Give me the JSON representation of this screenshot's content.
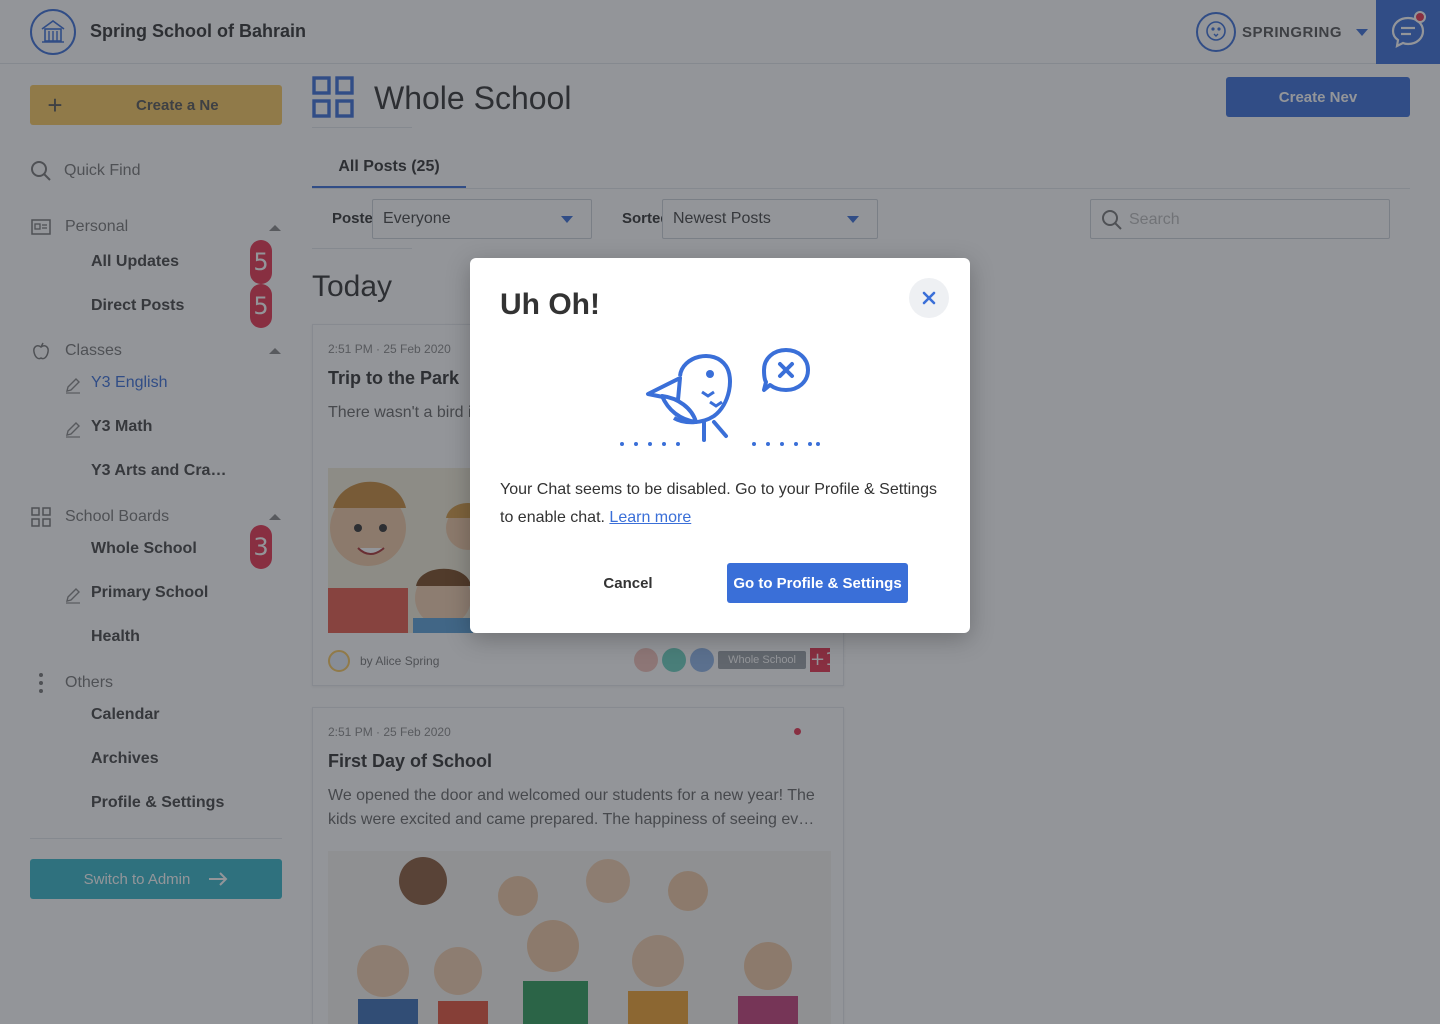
{
  "header": {
    "school_name": "Spring School of Bahrain",
    "user_name": "SPRINGRING"
  },
  "sidebar": {
    "create_label": "Create a Ne",
    "quick_find": "Quick Find",
    "sections": {
      "personal": {
        "label": "Personal",
        "items": [
          {
            "label": "All Updates",
            "badge": "5"
          },
          {
            "label": "Direct Posts",
            "badge": "5"
          }
        ]
      },
      "classes": {
        "label": "Classes",
        "items": [
          {
            "label": "Y3 English"
          },
          {
            "label": "Y3 Math"
          },
          {
            "label": "Y3 Arts and Cra…"
          }
        ]
      },
      "boards": {
        "label": "School Boards",
        "items": [
          {
            "label": "Whole School",
            "badge": "3"
          },
          {
            "label": "Primary School"
          },
          {
            "label": "Health"
          }
        ]
      },
      "others": {
        "label": "Others",
        "items": [
          {
            "label": "Calendar"
          },
          {
            "label": "Archives"
          },
          {
            "label": "Profile & Settings"
          }
        ]
      }
    },
    "switch_admin": "Switch to Admin"
  },
  "main": {
    "title": "Whole School",
    "create_new": "Create Nev",
    "tab_all": "All Posts (25)",
    "filters": {
      "posted_to_label": "Posted To",
      "posted_to_value": "Everyone",
      "sorted_by_label": "Sorted By",
      "sorted_by_value": "Newest Posts",
      "search_placeholder": "Search"
    },
    "section_today": "Today",
    "posts": [
      {
        "time": "2:51 PM · 25 Feb 2020",
        "title": "Trip to the Park",
        "excerpt": "There wasn't a bird i… attention. It was the…",
        "author": "by Alice Spring",
        "tag": "Whole School",
        "more": "+1"
      },
      {
        "time": "2:51 PM · 25 Feb 2020",
        "title": "First Day of School",
        "excerpt": "We opened the door and welcomed our students for a new year! The kids were excited and came prepared. The happiness of seeing ev…"
      }
    ]
  },
  "modal": {
    "title": "Uh Oh!",
    "message": "Your Chat seems to be disabled. Go to your Profile & Settings to enable chat.",
    "link": "Learn more",
    "cancel": "Cancel",
    "confirm": "Go to Profile & Settings"
  },
  "colors": {
    "accent": "#3a6fd8",
    "create_yellow": "#f9c85f",
    "admin_teal": "#36b7c9",
    "badge_red": "#e8334f",
    "overlay": "rgba(40,44,52,0.5)"
  },
  "icons": [
    "school-logo",
    "bird-avatar-icon",
    "chat-icon",
    "plus-icon",
    "search-icon",
    "id-card-icon",
    "apple-icon",
    "grid-icon",
    "more-vertical-icon",
    "pencil-icon",
    "arrow-right-icon",
    "close-icon",
    "sad-bird-illustration"
  ]
}
